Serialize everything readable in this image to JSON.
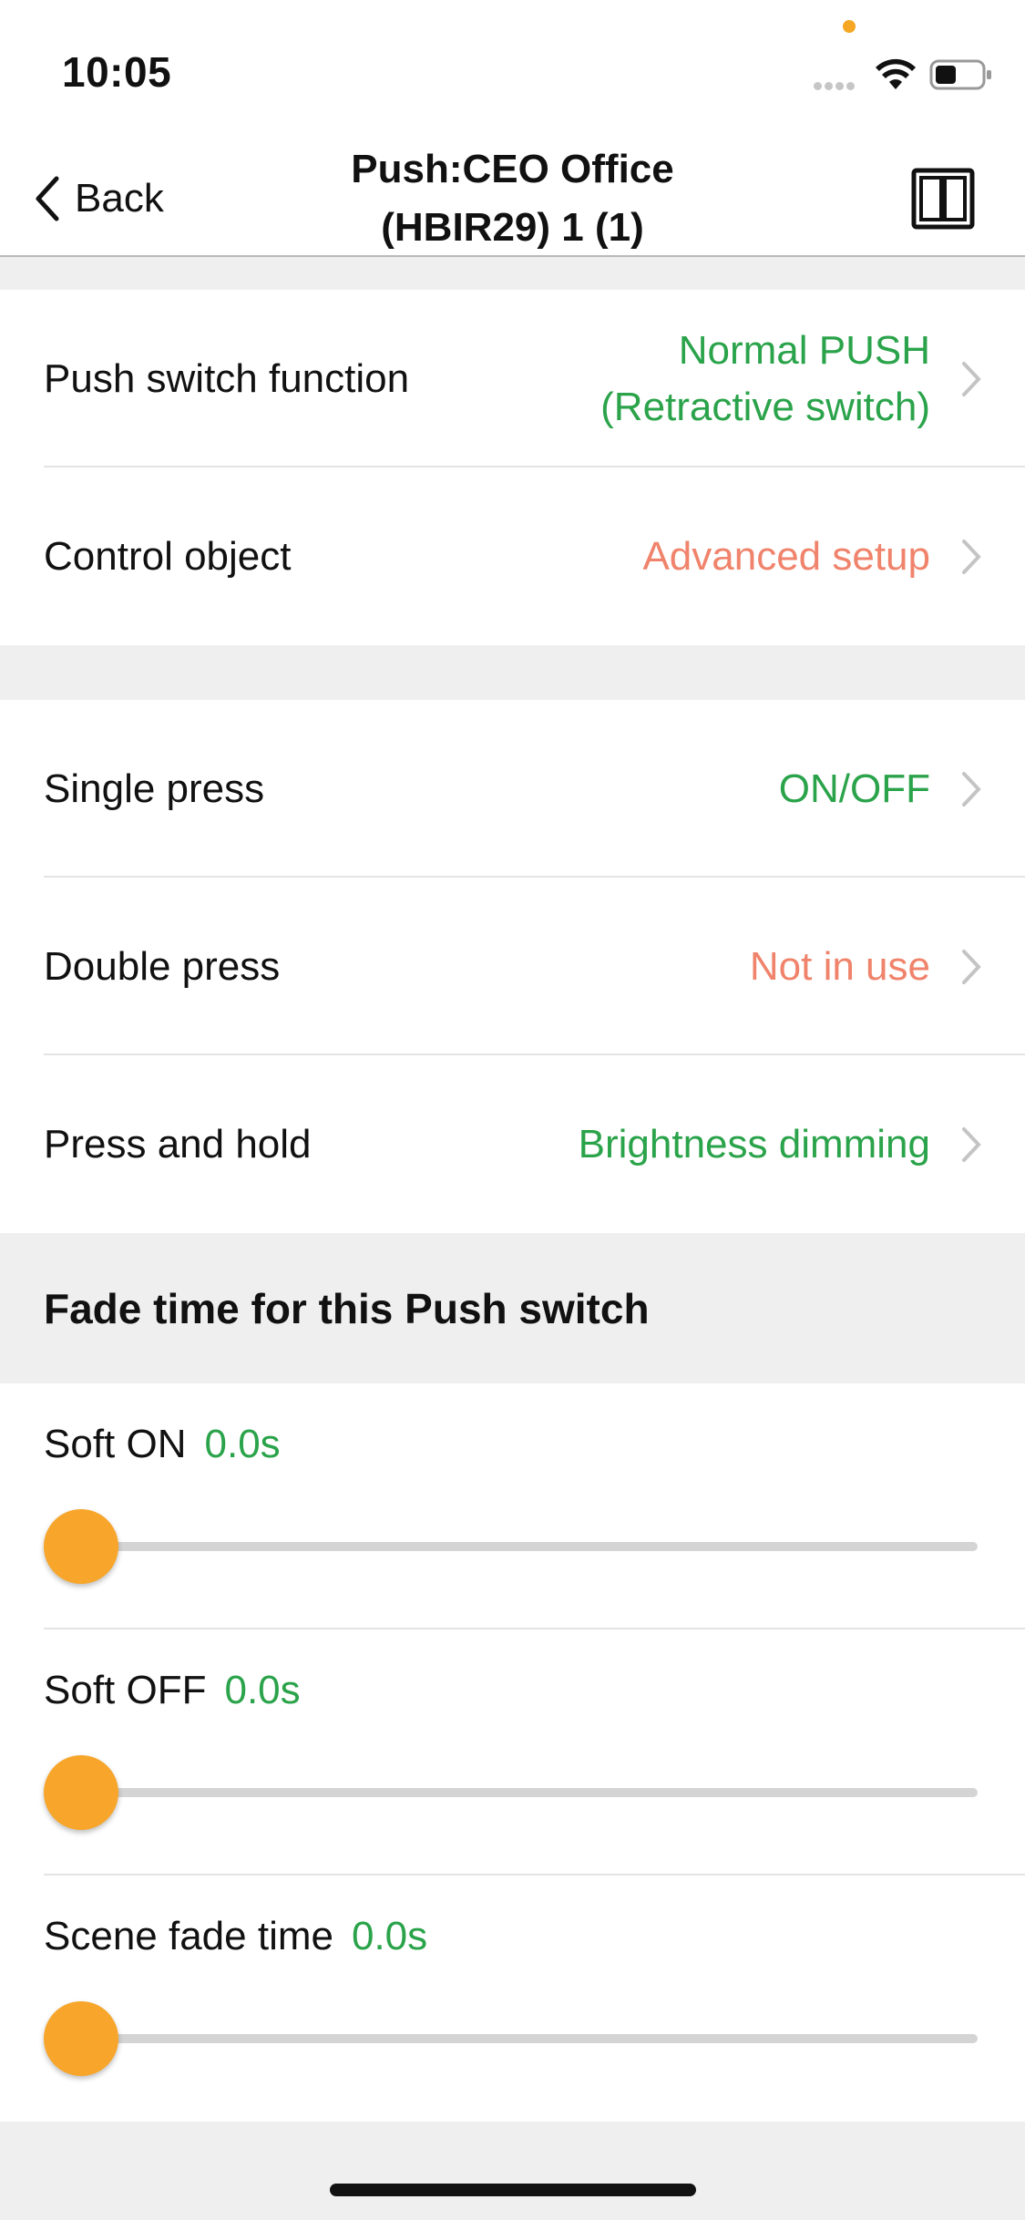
{
  "status_bar": {
    "time": "10:05"
  },
  "nav": {
    "back_label": "Back",
    "title_line1": "Push:CEO Office",
    "title_line2": "(HBIR29) 1 (1)"
  },
  "group1": [
    {
      "label": "Push switch function",
      "value_line1": "Normal PUSH",
      "value_line2": "(Retractive switch)",
      "color": "#2aa34a"
    },
    {
      "label": "Control object",
      "value": "Advanced setup",
      "color": "#f0836b"
    }
  ],
  "group2": [
    {
      "label": "Single press",
      "value": "ON/OFF",
      "color": "#2aa34a"
    },
    {
      "label": "Double press",
      "value": "Not in use",
      "color": "#f0836b"
    },
    {
      "label": "Press and hold",
      "value": "Brightness dimming",
      "color": "#2aa34a"
    }
  ],
  "fade_section": {
    "title": "Fade time for this Push switch",
    "sliders": [
      {
        "label": "Soft ON",
        "value": "0.0s",
        "level": 0
      },
      {
        "label": "Soft OFF",
        "value": "0.0s",
        "level": 0
      },
      {
        "label": "Scene fade time",
        "value": "0.0s",
        "level": 0
      }
    ]
  },
  "colors": {
    "accent_orange": "#f7a62b",
    "value_green": "#2aa34a",
    "value_salmon": "#f0836b"
  }
}
